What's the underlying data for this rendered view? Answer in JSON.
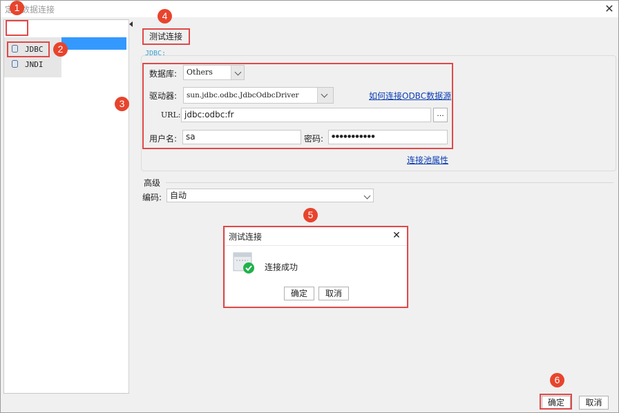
{
  "window": {
    "title": "定义数据连接"
  },
  "toolbar": {
    "add": "+",
    "add_caret": "▾",
    "delete": "✕",
    "up": "🠕",
    "down": "🠗"
  },
  "tree": {
    "items": [
      {
        "label": "JDBC"
      },
      {
        "label": "JNDI"
      }
    ]
  },
  "test_connection_label": "测试连接",
  "jdbc_group_label": "JDBC:",
  "form": {
    "database_label": "数据库:",
    "database_value": "Others",
    "driver_label": "驱动器:",
    "driver_value": "sun.jdbc.odbc.JdbcOdbcDriver",
    "odbc_link": "如何连接ODBC数据源",
    "url_label": "URL:",
    "url_value": "jdbc:odbc:fr",
    "browse_label": "...",
    "username_label": "用户名:",
    "username_value": "sa",
    "password_label": "密码:",
    "password_value": "●●●●●●●●●●●",
    "pool_link": "连接池属性"
  },
  "advanced": {
    "label": "高级",
    "encoding_label": "编码:",
    "encoding_value": "自动"
  },
  "dialog": {
    "title": "测试连接",
    "close": "✕",
    "message": "连接成功",
    "ok_label": "确定",
    "cancel_label": "取消"
  },
  "footer": {
    "ok_label": "确定",
    "cancel_label": "取消"
  },
  "badges": [
    "1",
    "2",
    "3",
    "4",
    "5",
    "6"
  ],
  "colors": {
    "highlight_red": "#e04848",
    "badge_red": "#e8442d",
    "selection_blue": "#3399ff",
    "link_blue": "#0b3db3",
    "success_green": "#1fb24a"
  }
}
